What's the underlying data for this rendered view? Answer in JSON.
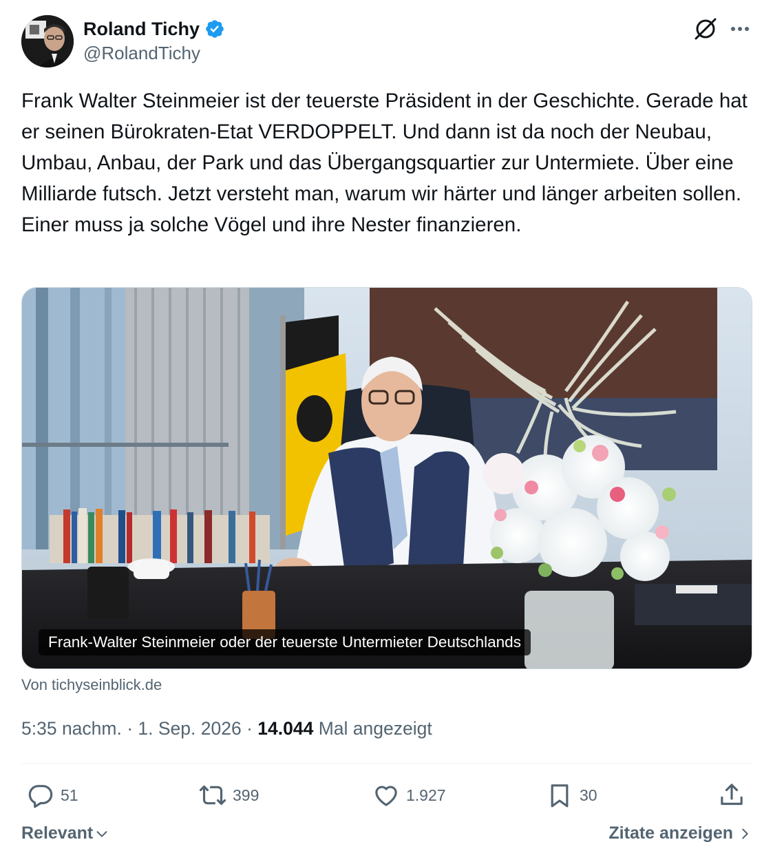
{
  "author": {
    "display_name": "Roland Tichy",
    "handle": "@RolandTichy",
    "verified_icon": "verified-badge-icon",
    "verified_color": "#1d9bf0"
  },
  "header_icons": {
    "grok": "grok-icon",
    "more": "more-icon"
  },
  "tweet": {
    "text": "Frank Walter Steinmeier ist der teuerste Präsident in der Geschichte. Gerade hat er seinen Bürokraten-Etat VERDOPPELT. Und dann ist da noch der Neubau, Umbau, Anbau, der Park und das Übergangsquartier zur Untermiete. Über eine Milliarde futsch. Jetzt versteht man, warum wir härter und länger arbeiten sollen. Einer muss ja solche Vögel und ihre Nester finanzieren."
  },
  "card": {
    "caption": "Frank-Walter Steinmeier oder der teuerste Untermieter Deutschlands",
    "source": "Von tichyseinblick.de"
  },
  "meta": {
    "time": "5:35 nachm.",
    "separator": " · ",
    "date": "1. Sep. 2026",
    "views_count": "14.044",
    "views_label": " Mal angezeigt"
  },
  "actions": {
    "replies": {
      "icon": "reply-icon",
      "count": "51"
    },
    "reposts": {
      "icon": "repost-icon",
      "count": "399"
    },
    "likes": {
      "icon": "like-icon",
      "count": "1.927"
    },
    "bookmarks": {
      "icon": "bookmark-icon",
      "count": "30"
    },
    "share": {
      "icon": "share-icon"
    }
  },
  "footer": {
    "sort_label": "Relevant",
    "quotes_label": "Zitate anzeigen"
  },
  "colors": {
    "text_primary": "#0f1419",
    "text_secondary": "#536471",
    "divider": "#eff3f4"
  }
}
